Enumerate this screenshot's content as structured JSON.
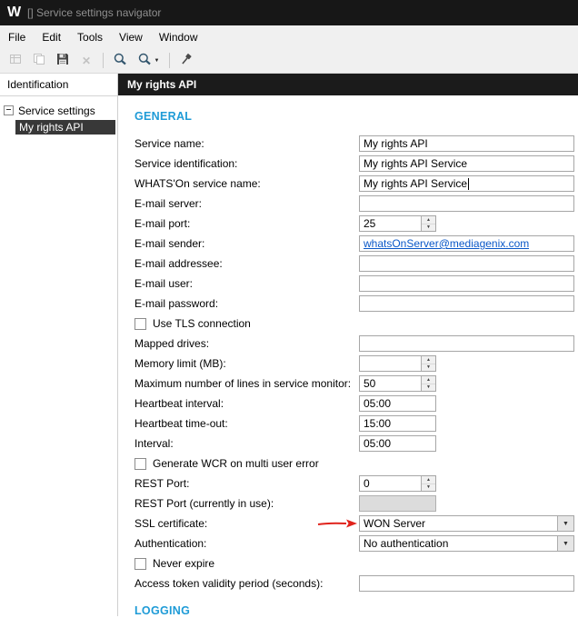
{
  "window": {
    "logo": "W",
    "title": "[] Service settings navigator"
  },
  "menubar": {
    "items": [
      "File",
      "Edit",
      "Tools",
      "View",
      "Window"
    ]
  },
  "toolbar": {
    "icons": [
      "grid-icon",
      "copy-icon",
      "save-icon",
      "delete-icon",
      "search-icon",
      "search-dropdown-icon",
      "hammer-icon"
    ]
  },
  "sidebar": {
    "header": "Identification",
    "root": "Service settings",
    "selected": "My rights API"
  },
  "main": {
    "header": "My rights API",
    "sections": {
      "general": "GENERAL",
      "logging": "LOGGING"
    },
    "rows": [
      {
        "label": "Service name:",
        "value": "My rights API"
      },
      {
        "label": "Service identification:",
        "value": "My rights API Service"
      },
      {
        "label": "WHATS'On service name:",
        "value": "My rights API Service"
      },
      {
        "label": "E-mail server:",
        "value": ""
      },
      {
        "label": "E-mail port:",
        "value": "25"
      },
      {
        "label": "E-mail sender:",
        "value": "whatsOnServer@mediagenix.com"
      },
      {
        "label": "E-mail addressee:",
        "value": ""
      },
      {
        "label": "E-mail user:",
        "value": ""
      },
      {
        "label": "E-mail password:",
        "value": ""
      },
      {
        "label": "Use TLS connection",
        "checked": false
      },
      {
        "label": "Mapped drives:",
        "value": ""
      },
      {
        "label": "Memory limit (MB):",
        "value": ""
      },
      {
        "label": "Maximum number of lines in service monitor:",
        "value": "50"
      },
      {
        "label": "Heartbeat interval:",
        "value": "05:00"
      },
      {
        "label": "Heartbeat time-out:",
        "value": "15:00"
      },
      {
        "label": "Interval:",
        "value": "05:00"
      },
      {
        "label": "Generate WCR on multi user error",
        "checked": false
      },
      {
        "label": "REST Port:",
        "value": "0"
      },
      {
        "label": "REST Port (currently in use):",
        "value": ""
      },
      {
        "label": "SSL certificate:",
        "value": "WON Server"
      },
      {
        "label": "Authentication:",
        "value": "No authentication"
      },
      {
        "label": "Never expire",
        "checked": false
      },
      {
        "label": "Access token validity period (seconds):",
        "value": ""
      }
    ]
  },
  "colors": {
    "accent_blue": "#1e9bd7",
    "link_blue": "#0a58c8",
    "annotation_red": "#e0231c",
    "header_dark": "#1b1b1b"
  }
}
